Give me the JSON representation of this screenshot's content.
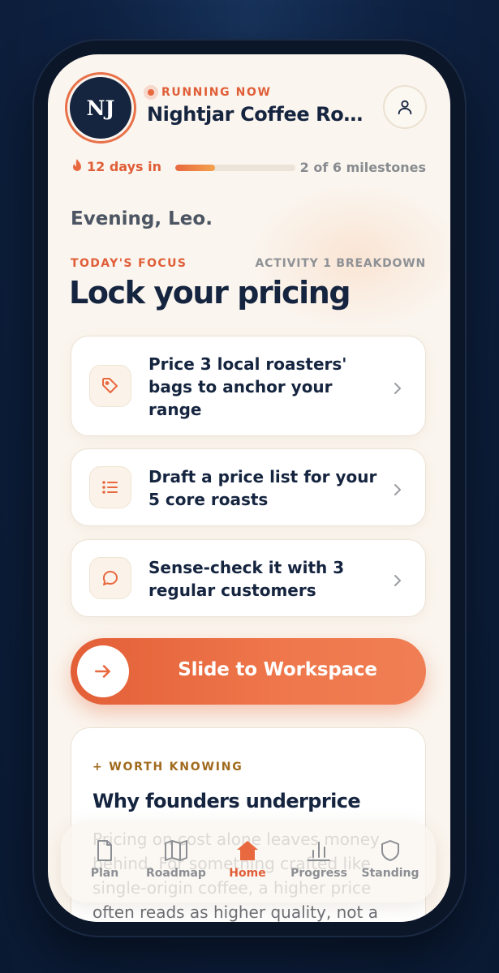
{
  "header": {
    "avatar_initials": "NJ",
    "status": "RUNNING NOW",
    "venture_name": "Nightjar Coffee Roasters",
    "profile_icon": "person-icon"
  },
  "progress": {
    "streak": "12 days in",
    "milestones_text": "2 of 6 milestones",
    "milestones_done": 2,
    "milestones_total": 6,
    "bar_fraction": 0.33
  },
  "greeting": "Evening, Leo.",
  "focus": {
    "label": "TODAY'S FOCUS",
    "activity": "ACTIVITY 1 BREAKDOWN",
    "title": "Lock your pricing"
  },
  "tasks": [
    {
      "icon": "tag-icon",
      "text": "Price 3 local roasters' bags to anchor your range"
    },
    {
      "icon": "list-icon",
      "text": "Draft a price list for your 5 core roasts"
    },
    {
      "icon": "chat-bubble-icon",
      "text": "Sense-check it with 3 regular customers"
    }
  ],
  "slide": {
    "label": "Slide to Workspace",
    "icon": "arrow-right-icon"
  },
  "worth_knowing": {
    "tag": "+ WORTH KNOWING",
    "title": "Why founders underprice",
    "body": "Pricing on cost alone leaves money behind. For something crafted like single-origin coffee, a higher price often reads as higher quality, not a"
  },
  "nav": {
    "items": [
      {
        "label": "Plan",
        "icon": "document-icon",
        "active": false
      },
      {
        "label": "Roadmap",
        "icon": "map-icon",
        "active": false
      },
      {
        "label": "Home",
        "icon": "home-icon",
        "active": true
      },
      {
        "label": "Progress",
        "icon": "bar-chart-icon",
        "active": false
      },
      {
        "label": "Standing",
        "icon": "shield-icon",
        "active": false
      }
    ]
  },
  "colors": {
    "accent": "#E8683F",
    "navy": "#15243F",
    "background": "#FAF5EE",
    "page_bg": "#0E2141"
  }
}
